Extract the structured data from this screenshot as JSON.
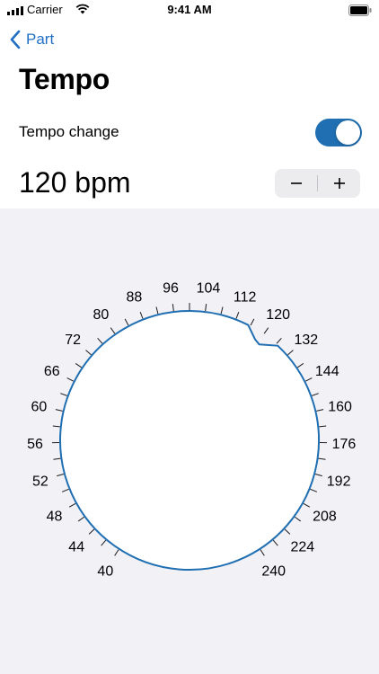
{
  "status_bar": {
    "carrier": "Carrier",
    "time": "9:41 AM"
  },
  "nav": {
    "back_label": "Part"
  },
  "page": {
    "title": "Tempo"
  },
  "tempo_change": {
    "label": "Tempo change",
    "enabled": true
  },
  "tempo": {
    "display": "120 bpm",
    "value_bpm": 120
  },
  "stepper": {
    "decrement_icon": "minus-icon",
    "increment_icon": "plus-icon"
  },
  "dial": {
    "tick_labels": [
      "40",
      "44",
      "48",
      "52",
      "56",
      "60",
      "66",
      "72",
      "80",
      "88",
      "96",
      "104",
      "112",
      "120",
      "132",
      "144",
      "160",
      "176",
      "192",
      "208",
      "224",
      "240"
    ],
    "selected_bpm": 120,
    "accent_color": "#1f6fb2"
  },
  "colors": {
    "accent": "#1f6fb2",
    "link": "#1f6fc5",
    "panel": "#f1f1f6"
  }
}
